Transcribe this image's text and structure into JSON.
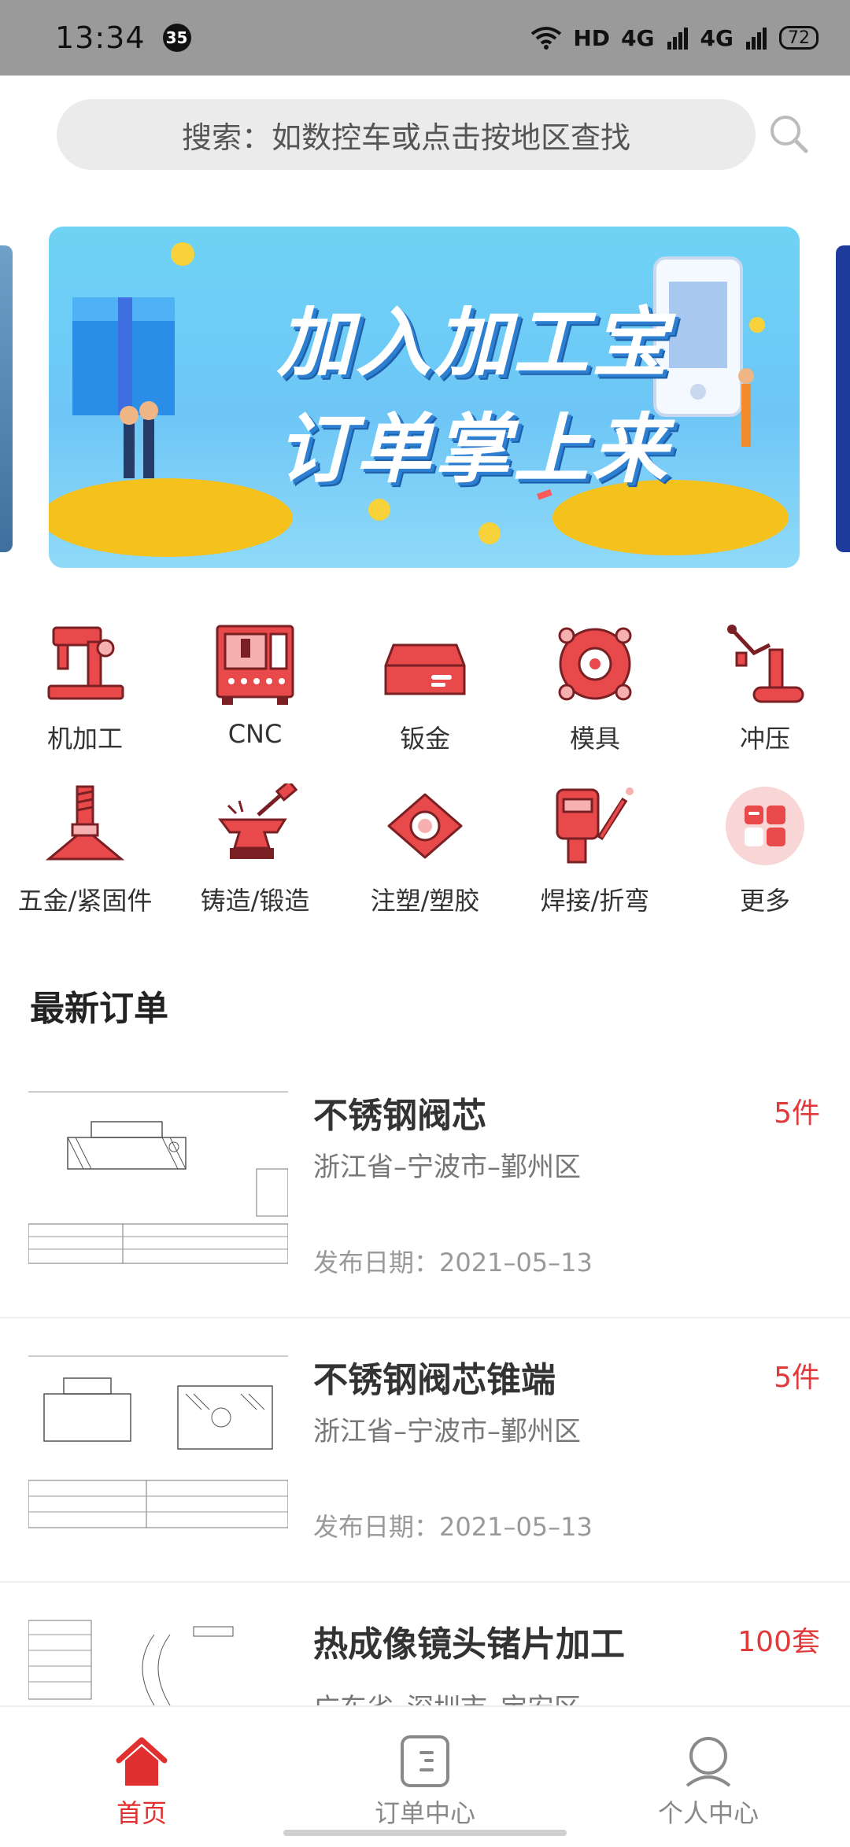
{
  "status_bar": {
    "time": "13:34",
    "notification_count": "35",
    "network": "HD",
    "signal_1": "4G",
    "signal_2": "4G",
    "battery": "72"
  },
  "search": {
    "placeholder": "搜索：如数控车或点击按地区查找"
  },
  "banner": {
    "line1": "加入加工宝",
    "line2": "订单掌上来"
  },
  "categories": [
    {
      "label": "机加工",
      "icon": "sewing-machine-icon"
    },
    {
      "label": "CNC",
      "icon": "cnc-machine-icon"
    },
    {
      "label": "钣金",
      "icon": "sheet-metal-box-icon"
    },
    {
      "label": "模具",
      "icon": "mold-icon"
    },
    {
      "label": "冲压",
      "icon": "stamping-arm-icon"
    },
    {
      "label": "五金/紧固件",
      "icon": "bolt-icon"
    },
    {
      "label": "铸造/锻造",
      "icon": "anvil-icon"
    },
    {
      "label": "注塑/塑胶",
      "icon": "flange-icon"
    },
    {
      "label": "焊接/折弯",
      "icon": "welding-icon"
    },
    {
      "label": "更多",
      "icon": "more-apps-icon"
    }
  ],
  "section": {
    "title": "最新订单"
  },
  "orders": [
    {
      "name": "不锈钢阀芯",
      "qty": "5件",
      "location": "浙江省–宁波市–鄞州区",
      "date": "发布日期：2021–05–13"
    },
    {
      "name": "不锈钢阀芯锥端",
      "qty": "5件",
      "location": "浙江省–宁波市–鄞州区",
      "date": "发布日期：2021–05–13"
    },
    {
      "name": "热成像镜头锗片加工",
      "qty": "100套",
      "location": "广东省–深圳市–宝安区",
      "date": ""
    }
  ],
  "tabs": [
    {
      "label": "首页",
      "icon": "home-icon",
      "active": true
    },
    {
      "label": "订单中心",
      "icon": "order-icon",
      "active": false
    },
    {
      "label": "个人中心",
      "icon": "user-icon",
      "active": false
    }
  ],
  "colors": {
    "brand_red": "#e0302f",
    "search_bg": "#ebebeb",
    "status_bar": "#9a9a9a"
  }
}
